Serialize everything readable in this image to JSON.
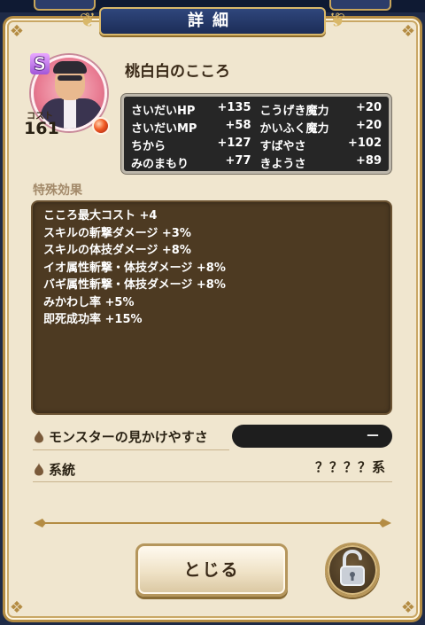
{
  "header": {
    "title": "詳細"
  },
  "monster": {
    "rank": "S",
    "name": "桃白白のこころ",
    "cost_label": "コスト",
    "cost_value": "161"
  },
  "stats": [
    [
      {
        "label": "さいだいHP",
        "value": "+135"
      },
      {
        "label": "こうげき魔力",
        "value": "+20"
      }
    ],
    [
      {
        "label": "さいだいMP",
        "value": "+58"
      },
      {
        "label": "かいふく魔力",
        "value": "+20"
      }
    ],
    [
      {
        "label": "ちから",
        "value": "+127"
      },
      {
        "label": "すばやさ",
        "value": "+102"
      }
    ],
    [
      {
        "label": "みのまもり",
        "value": "+77"
      },
      {
        "label": "きようさ",
        "value": "+89"
      }
    ]
  ],
  "special": {
    "label": "特殊効果",
    "effects": [
      "こころ最大コスト +4",
      "スキルの斬撃ダメージ +3%",
      "スキルの体技ダメージ +8%",
      "イオ属性斬撃・体技ダメージ +8%",
      "バギ属性斬撃・体技ダメージ +8%",
      "みかわし率 +5%",
      "即死成功率 +15%"
    ]
  },
  "appearance": {
    "label": "モンスターの見かけやすさ",
    "value": "－"
  },
  "lineage": {
    "label": "系統",
    "value": "？？？？系"
  },
  "buttons": {
    "close_label": "とじる"
  },
  "icons": {
    "lock": "unlock-icon",
    "drop": "droplet-icon"
  },
  "colors": {
    "panel": "#f0e6cf",
    "header": "#1c2d57",
    "stats_bg": "#262626",
    "effects_bg": "#4d3a22"
  }
}
